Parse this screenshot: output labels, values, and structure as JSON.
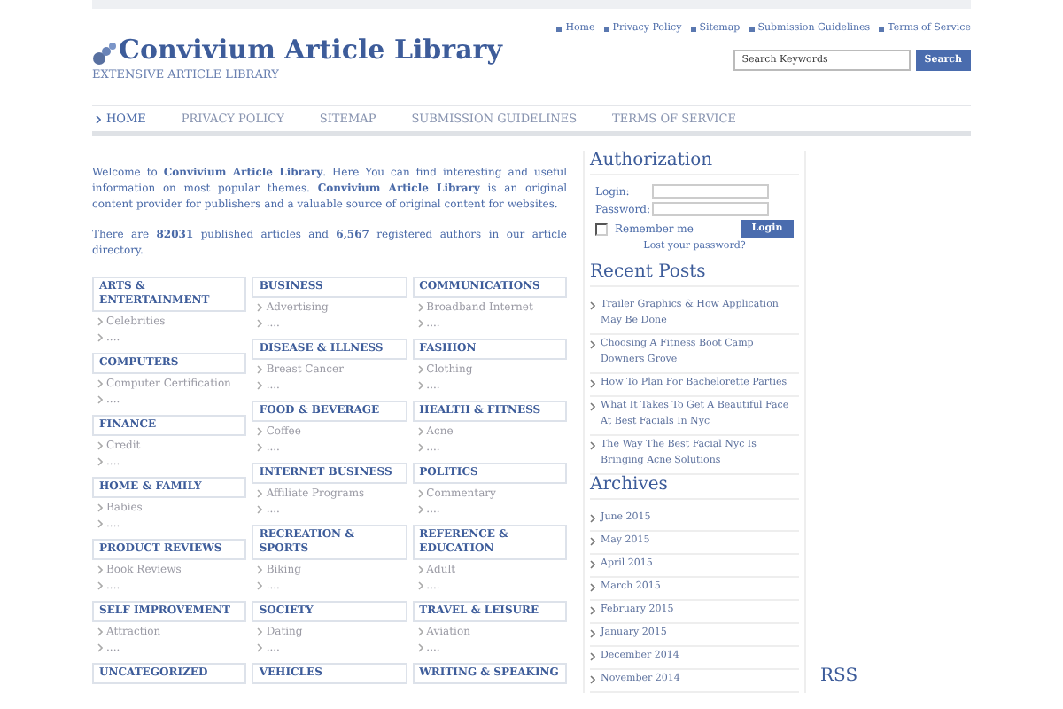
{
  "site": {
    "title": "Convivium Article Library",
    "tagline": "EXTENSIVE ARTICLE LIBRARY"
  },
  "top_links": [
    "Home",
    "Privacy Policy",
    "Sitemap",
    "Submission Guidelines",
    "Terms of Service"
  ],
  "search": {
    "placeholder": "Search Keywords",
    "button": "Search"
  },
  "nav": [
    {
      "label": "HOME",
      "selected": true
    },
    {
      "label": "PRIVACY POLICY",
      "selected": false
    },
    {
      "label": "SITEMAP",
      "selected": false
    },
    {
      "label": "SUBMISSION GUIDELINES",
      "selected": false
    },
    {
      "label": "TERMS OF SERVICE",
      "selected": false
    }
  ],
  "intro": [
    "Welcome to **Convivium Article Library**. Here You can find interesting and useful information on most popular themes. **Convivium Article Library** is an original content provider for publishers and a valuable source of original content for websites.",
    "There are **82031** published articles and **6,567** registered authors in our article directory."
  ],
  "category_columns": [
    [
      {
        "title": "ARTS & ENTERTAINMENT",
        "links": [
          "Celebrities",
          "...."
        ]
      },
      {
        "title": "COMPUTERS",
        "links": [
          "Computer Certification",
          "...."
        ]
      },
      {
        "title": "FINANCE",
        "links": [
          "Credit",
          "...."
        ]
      },
      {
        "title": "HOME & FAMILY",
        "links": [
          "Babies",
          "...."
        ]
      },
      {
        "title": "PRODUCT REVIEWS",
        "links": [
          "Book Reviews",
          "...."
        ]
      },
      {
        "title": "SELF IMPROVEMENT",
        "links": [
          "Attraction",
          "...."
        ]
      },
      {
        "title": "UNCATEGORIZED"
      }
    ],
    [
      {
        "title": "BUSINESS",
        "links": [
          "Advertising",
          "...."
        ]
      },
      {
        "title": "DISEASE & ILLNESS",
        "links": [
          "Breast Cancer",
          "...."
        ]
      },
      {
        "title": "FOOD & BEVERAGE",
        "links": [
          "Coffee",
          "...."
        ]
      },
      {
        "title": "INTERNET BUSINESS",
        "links": [
          "Affiliate Programs",
          "...."
        ]
      },
      {
        "title": "RECREATION & SPORTS",
        "links": [
          "Biking",
          "...."
        ]
      },
      {
        "title": "SOCIETY",
        "links": [
          "Dating",
          "...."
        ]
      },
      {
        "title": "VEHICLES"
      }
    ],
    [
      {
        "title": "COMMUNICATIONS",
        "links": [
          "Broadband Internet",
          "...."
        ]
      },
      {
        "title": "FASHION",
        "links": [
          "Clothing",
          "...."
        ]
      },
      {
        "title": "HEALTH & FITNESS",
        "links": [
          "Acne",
          "...."
        ]
      },
      {
        "title": "POLITICS",
        "links": [
          "Commentary",
          "...."
        ]
      },
      {
        "title": "REFERENCE & EDUCATION",
        "links": [
          "Adult",
          "...."
        ]
      },
      {
        "title": "TRAVEL & LEISURE",
        "links": [
          "Aviation",
          "...."
        ]
      },
      {
        "title": "WRITING & SPEAKING"
      }
    ]
  ],
  "authorization": {
    "title": "Authorization",
    "login_label": "Login:",
    "password_label": "Password:",
    "remember": {
      "label": "Remember me",
      "checked": false
    },
    "button": "Login",
    "lost_password": "Lost your password?"
  },
  "recent_posts": {
    "title": "Recent Posts",
    "items": [
      "Trailer Graphics & How Application May Be Done",
      "Choosing A Fitness Boot Camp Downers Grove",
      "How To Plan For Bachelorette Parties",
      "What It Takes To Get A Beautiful Face At Best Facials In Nyc",
      "The Way The Best Facial Nyc Is Bringing Acne Solutions"
    ]
  },
  "archives": {
    "title": "Archives",
    "items": [
      "June 2015",
      "May 2015",
      "April 2015",
      "March 2015",
      "February 2015",
      "January 2015",
      "December 2014",
      "November 2014"
    ]
  },
  "rss": {
    "title": "RSS"
  }
}
